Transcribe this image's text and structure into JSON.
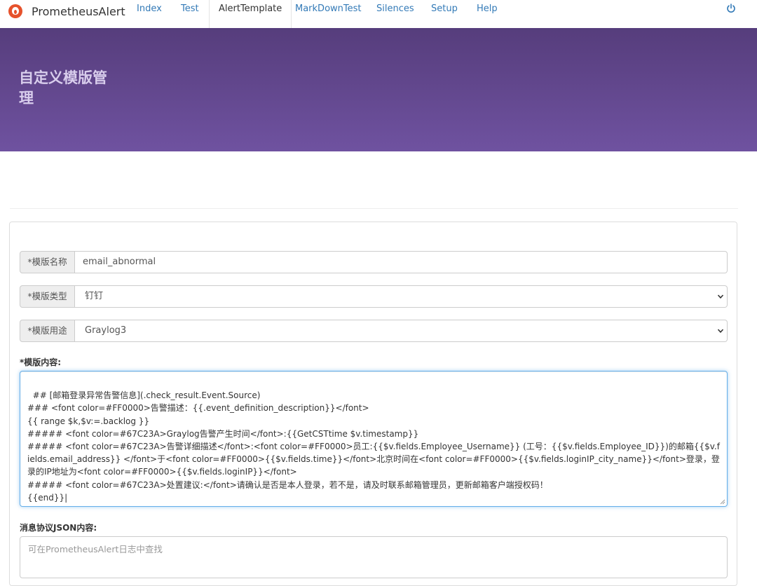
{
  "navbar": {
    "brand": "PrometheusAlert",
    "items": [
      {
        "label": "Index"
      },
      {
        "label": "Test"
      },
      {
        "label": "AlertTemplate"
      },
      {
        "label": "MarkDownTest"
      },
      {
        "label": "Silences"
      },
      {
        "label": "Setup"
      },
      {
        "label": "Help"
      }
    ],
    "active": "AlertTemplate"
  },
  "hero": {
    "title": "自定义模版管理"
  },
  "form": {
    "name_label": "*模版名称",
    "name_value": "email_abnormal",
    "type_label": "*模版类型",
    "type_value": "钉钉",
    "usage_label": "*模版用途",
    "usage_value": "Graylog3",
    "content_label": "*模版内容:",
    "content_value": "## [邮箱登录异常告警信息](.check_result.Event.Source)\n### <font color=#FF0000>告警描述：{{.event_definition_description}}</font>\n{{ range $k,$v:=.backlog }}\n##### <font color=#67C23A>Graylog告警产生时间</font>:{{GetCSTtime $v.timestamp}}\n##### <font color=#67C23A>告警详细描述</font>:<font color=#FF0000>员工:{{$v.fields.Employee_Username}} (工号：{{$v.fields.Employee_ID}})的邮箱{{$v.fields.email_address}} </font>于<font color=#FF0000>{{$v.fields.time}}</font>北京时间在<font color=#FF0000>{{$v.fields.loginIP_city_name}}</font>登录，登录的IP地址为<font color=#FF0000>{{$v.fields.loginIP}}</font>\n##### <font color=#67C23A>处置建议:</font>请确认是否是本人登录，若不是，请及时联系邮箱管理员，更新邮箱客户端授权码！\n{{end}}|",
    "json_label": "消息协议JSON内容:",
    "json_placeholder": "可在PrometheusAlert日志中查找"
  },
  "colors": {
    "brand_orange": "#e6522c",
    "hero_top": "#563d7c",
    "hero_bottom": "#6f52a0",
    "link": "#337ab7"
  }
}
